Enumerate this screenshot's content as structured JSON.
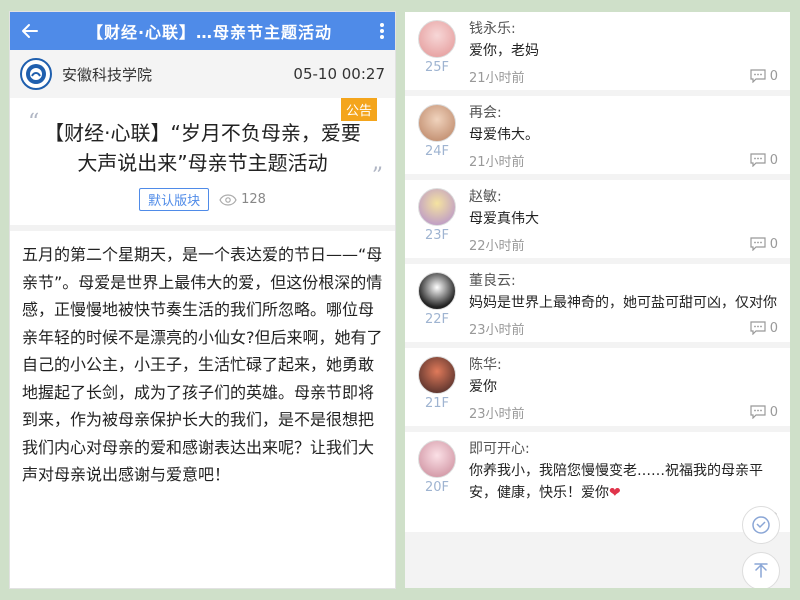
{
  "left": {
    "topbar": {
      "title": "【财经·心联】…母亲节主题活动"
    },
    "author": {
      "name": "安徽科技学院",
      "time": "05-10 00:27"
    },
    "badge": "公告",
    "title": "【财经·心联】“岁月不负母亲，爱要大声说出来”母亲节主题活动",
    "board": "默认版块",
    "views": "128",
    "body": "五月的第二个星期天，是一个表达爱的节日——“母亲节”。母爱是世界上最伟大的爱，但这份根深的情感，正慢慢地被快节奏生活的我们所忽略。哪位母亲年轻的时候不是漂亮的小仙女?但后来啊，她有了自己的小公主，小王子，生活忙碌了起来，她勇敢地握起了长剑，成为了孩子们的英雄。母亲节即将到来，作为被母亲保护长大的我们，是不是很想把我们内心对母亲的爱和感谢表达出来呢？让我们大声对母亲说出感谢与爱意吧！"
  },
  "comments": [
    {
      "name": "钱永乐:",
      "text": "爱你，老妈",
      "floor": "25F",
      "time": "21小时前",
      "replies": "0",
      "avatar_color": "#e8a3a3"
    },
    {
      "name": "再会:",
      "text": "母爱伟大。",
      "floor": "24F",
      "time": "21小时前",
      "replies": "0",
      "avatar_color": "#c89a7a"
    },
    {
      "name": "赵敏:",
      "text": "母爱真伟大",
      "floor": "23F",
      "time": "22小时前",
      "replies": "0",
      "avatar_color": "#d9b3e6"
    },
    {
      "name": "董良云:",
      "text": "妈妈是世界上最神奇的，她可盐可甜可凶，仅对你",
      "floor": "22F",
      "time": "23小时前",
      "replies": "0",
      "avatar_color": "#333333"
    },
    {
      "name": "陈华:",
      "text": "爱你",
      "floor": "21F",
      "time": "23小时前",
      "replies": "0",
      "avatar_color": "#7a3b3b"
    },
    {
      "name": "即可开心:",
      "text": "你养我小，我陪您慢慢变老……祝福我的母亲平安，健康，快乐！爱你",
      "heart": "❤",
      "floor": "20F",
      "time": "",
      "replies": "0",
      "avatar_color": "#e6a6b3"
    }
  ]
}
